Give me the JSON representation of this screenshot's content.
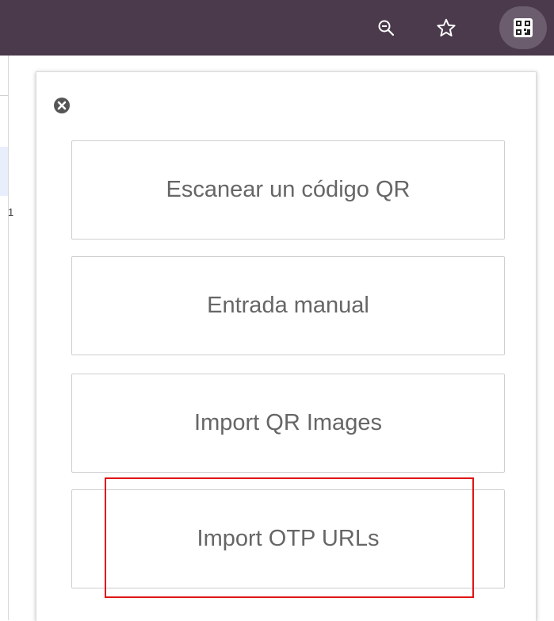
{
  "browser_toolbar": {
    "icons": [
      "zoom-out-icon",
      "star-icon",
      "qr-extension-icon"
    ]
  },
  "popup": {
    "close_icon": "close-icon",
    "buttons": [
      {
        "label": "Escanear un código QR"
      },
      {
        "label": "Entrada manual"
      },
      {
        "label": "Import QR Images"
      },
      {
        "label": "Import OTP URLs"
      }
    ]
  },
  "background_page": {
    "fragment_text": "1"
  },
  "colors": {
    "toolbar_bg": "#4a3a4c",
    "button_text": "#666666",
    "highlight": "#e01515"
  }
}
